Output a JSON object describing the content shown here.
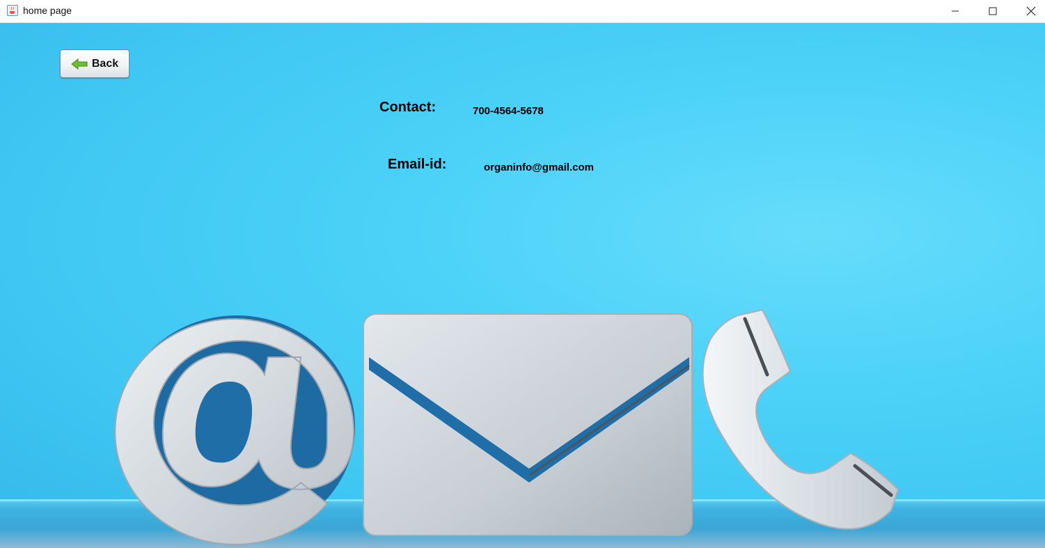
{
  "window": {
    "title": "home page",
    "icon": "java-cup-icon",
    "controls": {
      "minimize": "minimize-icon",
      "maximize": "maximize-icon",
      "close": "close-icon"
    }
  },
  "back_button": {
    "label": "Back",
    "icon": "green-left-arrow-icon"
  },
  "contact": {
    "label": "Contact:",
    "value": "700-4564-5678"
  },
  "email": {
    "label": "Email-id:",
    "value": "organinfo@gmail.com"
  },
  "colors": {
    "background_blue": "#4cd2f8",
    "icon_gray": "#c9d0d6",
    "icon_blue": "#1f6ea8"
  }
}
